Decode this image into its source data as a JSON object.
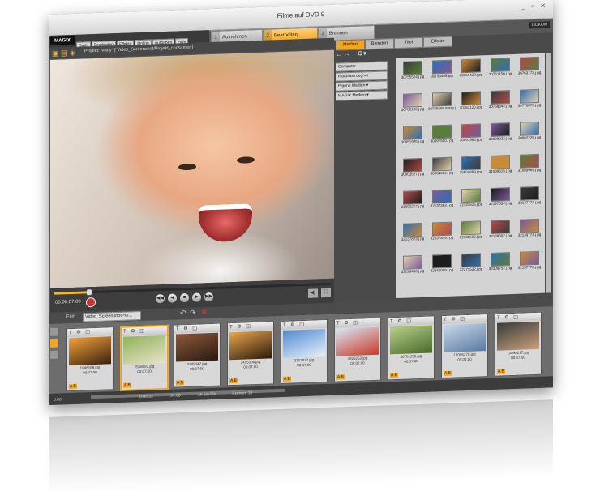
{
  "window": {
    "title": "Filme auf DVD 9",
    "controls": "_ ▫ ✕"
  },
  "menubar": {
    "logo": "MAGIX",
    "items": [
      "Datei",
      "Bearbeiten",
      "Effekte",
      "Online",
      "Aufgaben",
      "Hilfe"
    ]
  },
  "mode_tabs": [
    {
      "num": "1",
      "label": "Aufnehmen"
    },
    {
      "num": "2",
      "label": "Bearbeiten",
      "active": true
    },
    {
      "num": "3",
      "label": "Brennen"
    }
  ],
  "brand_label": "GOKOM",
  "pathbar": {
    "path": "Projekt: Matty* [ Video_Screenshot/Projekt_consumer ]"
  },
  "transport": {
    "time": "00:00:07:00"
  },
  "media_tabs": [
    {
      "label": "Medien",
      "active": true
    },
    {
      "label": "Blenden"
    },
    {
      "label": "Titel"
    },
    {
      "label": "Effekte"
    }
  ],
  "folders": [
    "Computer",
    "matthias.ruegner",
    "Eigene Medien ▾",
    "MAGIX Medien ▾"
  ],
  "media_grid": {
    "rows": [
      [
        "30755504.j pg",
        "30755505.jpg",
        "30759422.j pg",
        "30761150.j pg",
        "30763172.j pg"
      ],
      [
        "30768196.j pg",
        "30766598 Matty.jpg",
        "30767120.j pg",
        "30768344.j pg",
        "30770078.j pg"
      ],
      [
        "30851925.j pg",
        "30897550.j pg",
        "30897568.j pg",
        "30898222.j pg",
        "30902229.j pg"
      ],
      [
        "30903527.j pg",
        "30904682.j pg",
        "30904869.j pg",
        "31089315.j pg",
        "31089985.j pg"
      ],
      [
        "31090217.j pg",
        "32137362.j pg",
        "32137626.j pg",
        "32137634.j pg",
        "32137777.j pg"
      ],
      [
        "32137823.j pg",
        "32137849.j pg",
        "32138569.j pg",
        "32138602.j pg",
        "32138774.j pg"
      ],
      [
        "32229416.j pg",
        "32240009.j pg",
        "32271532.j pg",
        "32308752.j pg",
        "32137772.j pg"
      ]
    ]
  },
  "timeline_header": {
    "label": "Film",
    "project": "Video_ScreenshotPro..."
  },
  "clips": [
    {
      "name": "1948168.jpg",
      "dur": "00:07:00"
    },
    {
      "name": "2568093.jpg",
      "dur": "00:07:00"
    },
    {
      "name": "3389042.jpg",
      "dur": "00:07:00"
    },
    {
      "name": "3415306.jpg",
      "dur": "00:07:00"
    },
    {
      "name": "3702832.jpg",
      "dur": "00:07:00"
    },
    {
      "name": "3926252.jpg",
      "dur": "00:07:00"
    },
    {
      "name": "30761150.jpg",
      "dur": "00:07:00"
    },
    {
      "name": "13096279.jpg",
      "dur": "00:07:00"
    },
    {
      "name": "11090217.jpg",
      "dur": "00:07:00"
    }
  ],
  "status": {
    "left": "0:00",
    "items": [
      "0:00:33",
      "37:88",
      "1h 5m 59s",
      "Szenen: 10"
    ]
  }
}
